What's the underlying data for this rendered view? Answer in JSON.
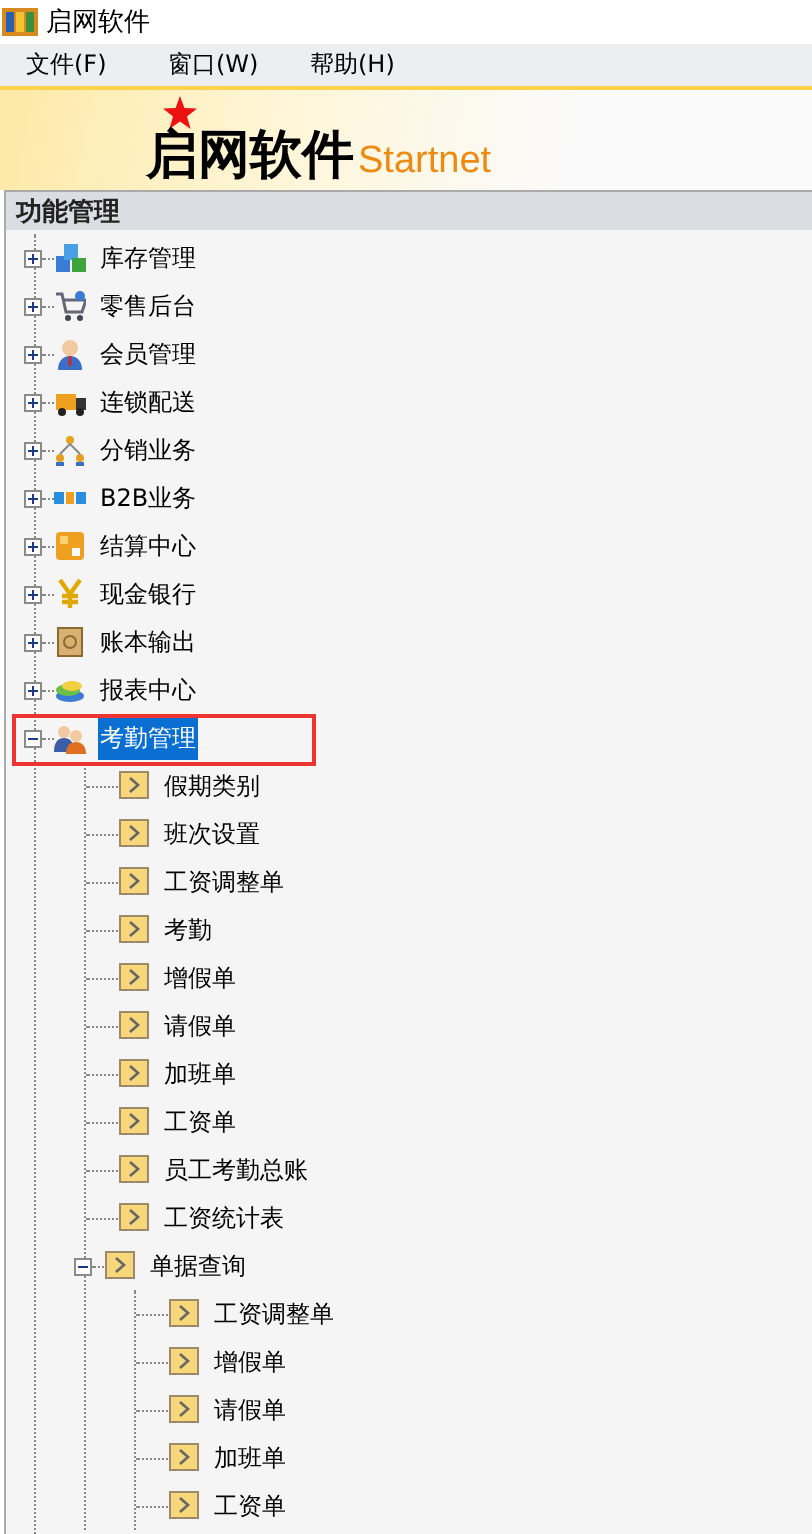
{
  "window": {
    "title": "启网软件"
  },
  "menu": [
    "文件(F)",
    "窗口(W)",
    "帮助(H)"
  ],
  "banner": {
    "name": "启网软件",
    "tagline": "Startnet"
  },
  "panel": {
    "title": "功能管理",
    "tree": [
      {
        "label": "库存管理",
        "expanded": false,
        "selected": false
      },
      {
        "label": "零售后台",
        "expanded": false,
        "selected": false
      },
      {
        "label": "会员管理",
        "expanded": false,
        "selected": false
      },
      {
        "label": "连锁配送",
        "expanded": false,
        "selected": false
      },
      {
        "label": "分销业务",
        "expanded": false,
        "selected": false
      },
      {
        "label": "B2B业务",
        "expanded": false,
        "selected": false
      },
      {
        "label": "结算中心",
        "expanded": false,
        "selected": false
      },
      {
        "label": "现金银行",
        "expanded": false,
        "selected": false
      },
      {
        "label": "账本输出",
        "expanded": false,
        "selected": false
      },
      {
        "label": "报表中心",
        "expanded": false,
        "selected": false
      },
      {
        "label": "考勤管理",
        "expanded": true,
        "selected": true,
        "outlined": true,
        "children": [
          {
            "label": "假期类别",
            "selected": false
          },
          {
            "label": "班次设置",
            "selected": false
          },
          {
            "label": "工资调整单",
            "selected": false
          },
          {
            "label": "考勤",
            "selected": false
          },
          {
            "label": "增假单",
            "selected": false
          },
          {
            "label": "请假单",
            "selected": false
          },
          {
            "label": "加班单",
            "selected": false
          },
          {
            "label": "工资单",
            "selected": false
          },
          {
            "label": "员工考勤总账",
            "selected": false
          },
          {
            "label": "工资统计表",
            "selected": false
          },
          {
            "label": "单据查询",
            "expanded": true,
            "selected": false,
            "children": [
              {
                "label": "工资调整单",
                "selected": false
              },
              {
                "label": "增假单",
                "selected": false
              },
              {
                "label": "请假单",
                "selected": false
              },
              {
                "label": "加班单",
                "selected": false
              },
              {
                "label": "工资单",
                "selected": false
              }
            ]
          }
        ]
      }
    ]
  }
}
